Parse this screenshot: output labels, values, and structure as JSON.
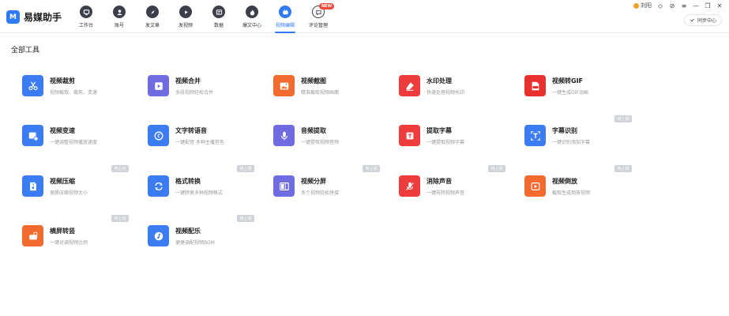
{
  "app": {
    "logo_mark": "M",
    "title": "易媒助手"
  },
  "nav": [
    {
      "label": "工作台",
      "icon": "dashboard-icon"
    },
    {
      "label": "账号",
      "icon": "account-icon"
    },
    {
      "label": "发文章",
      "icon": "compass-icon"
    },
    {
      "label": "发视频",
      "icon": "play-icon"
    },
    {
      "label": "数据",
      "icon": "data-icon"
    },
    {
      "label": "爆文中心",
      "icon": "fire-icon"
    },
    {
      "label": "视频编辑",
      "icon": "video-edit-icon",
      "active": true
    },
    {
      "label": "评论管理",
      "icon": "comment-icon",
      "badge": "NEW"
    }
  ],
  "window": {
    "user": "刘阳",
    "sync_label": "同步中心"
  },
  "section_title": "全部工具",
  "pending_label": "待上线",
  "tools": [
    {
      "name": "视频裁剪",
      "desc": "视频截取、裁剪、变速",
      "color": "#3b7cf3",
      "icon": "scissors-icon"
    },
    {
      "name": "视频合并",
      "desc": "多段视频轻松合并",
      "color": "#6e6ce0",
      "icon": "merge-icon"
    },
    {
      "name": "视频截图",
      "desc": "精准截取视频画面",
      "color": "#f26a2e",
      "icon": "screenshot-icon"
    },
    {
      "name": "水印处理",
      "desc": "快速处理视频水印",
      "color": "#ee3b3b",
      "icon": "eraser-icon"
    },
    {
      "name": "视频转GIF",
      "desc": "一键生成GIF动画",
      "color": "#e8312f",
      "icon": "gif-icon"
    },
    {
      "name": "视频变速",
      "desc": "一键调整视频播放速度",
      "color": "#3b7cf3",
      "icon": "speed-icon"
    },
    {
      "name": "文字转语音",
      "desc": "一键配音 多种主播音色",
      "color": "#3b7cf3",
      "icon": "text-speech-icon"
    },
    {
      "name": "音频提取",
      "desc": "一键提取视频音频",
      "color": "#6e6ce0",
      "icon": "microphone-icon"
    },
    {
      "name": "提取字幕",
      "desc": "一键提取视频字幕",
      "color": "#ee3b3b",
      "icon": "subtitle-icon"
    },
    {
      "name": "字幕识别",
      "desc": "一键识别添加字幕",
      "color": "#3b7cf3",
      "icon": "text-recognize-icon",
      "pending": true
    },
    {
      "name": "视频压缩",
      "desc": "保质压缩视频大小",
      "color": "#3b7cf3",
      "icon": "compress-icon",
      "pending": true
    },
    {
      "name": "格式转换",
      "desc": "一键转换多种视频格式",
      "color": "#3b7cf3",
      "icon": "convert-icon",
      "pending": true
    },
    {
      "name": "视频分屏",
      "desc": "多个视频轻松拼接",
      "color": "#6e6ce0",
      "icon": "split-screen-icon",
      "pending": true
    },
    {
      "name": "消除声音",
      "desc": "一键去除视频声音",
      "color": "#ee3b3b",
      "icon": "mute-icon",
      "pending": true
    },
    {
      "name": "视频倒放",
      "desc": "截取生成倒放视频",
      "color": "#f26a2e",
      "icon": "reverse-icon",
      "pending": true
    },
    {
      "name": "横屏转竖",
      "desc": "一键对调视频比例",
      "color": "#f26a2e",
      "icon": "rotate-icon"
    },
    {
      "name": "视频配乐",
      "desc": "便捷调配视频BGM",
      "color": "#3b7cf3",
      "icon": "music-icon",
      "pending": true
    }
  ]
}
